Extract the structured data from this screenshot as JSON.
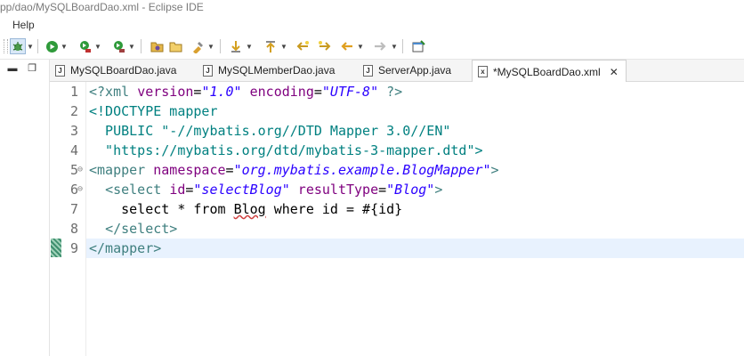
{
  "window": {
    "title": "pp/dao/MySQLBoardDao.xml - Eclipse IDE"
  },
  "menu": {
    "items": [
      {
        "label": "Help"
      }
    ]
  },
  "toolbar": {
    "icons": [
      "debug-icon",
      "run-icon",
      "coverage-icon",
      "external-tools-icon",
      "open-type-icon",
      "open-folder-icon",
      "open-task-icon",
      "next-annotation-icon",
      "prev-annotation-icon",
      "last-edit-icon",
      "next-edit-icon",
      "back-icon",
      "forward-icon",
      "pin-editor-icon"
    ]
  },
  "tabs": [
    {
      "label": "MySQLBoardDao.java",
      "icon": "J",
      "active": false
    },
    {
      "label": "MySQLMemberDao.java",
      "icon": "J",
      "active": false
    },
    {
      "label": "ServerApp.java",
      "icon": "J",
      "active": false
    },
    {
      "label": "*MySQLBoardDao.xml",
      "icon": "x",
      "active": true,
      "close": "✕"
    }
  ],
  "editor": {
    "line_numbers": [
      "1",
      "2",
      "3",
      "4",
      "5",
      "6",
      "7",
      "8",
      "9"
    ],
    "lines": {
      "l1": {
        "open": "<?xml ",
        "a1": "version",
        "eq1": "=",
        "v1": "\"1.0\"",
        "a2": " encoding",
        "eq2": "=",
        "v2": "\"UTF-8\"",
        "close": " ?>"
      },
      "l2": {
        "text": "<!DOCTYPE mapper"
      },
      "l3": {
        "text": "  PUBLIC \"-//mybatis.org//DTD Mapper 3.0//EN\""
      },
      "l4": {
        "text": "  \"https://mybatis.org/dtd/mybatis-3-mapper.dtd\">"
      },
      "l5": {
        "open": "<mapper ",
        "a1": "namespace",
        "eq1": "=",
        "v1": "\"org.mybatis.example.BlogMapper\"",
        "close": ">"
      },
      "l6": {
        "indent": "  ",
        "open": "<select ",
        "a1": "id",
        "eq1": "=",
        "v1": "\"selectBlog\"",
        "a2": " resultType",
        "eq2": "=",
        "v2": "\"Blog\"",
        "close": ">"
      },
      "l7": {
        "pre": "    select * from ",
        "spell": "Blog",
        "post": " where id = #{id}"
      },
      "l8": {
        "indent": "  ",
        "tag": "</select>"
      },
      "l9": {
        "tag": "</mapper>"
      }
    }
  },
  "colors": {
    "tag": "#3f7f7f",
    "attr": "#7f007f",
    "value": "#2a00ff",
    "current_line": "#e8f2fe"
  }
}
